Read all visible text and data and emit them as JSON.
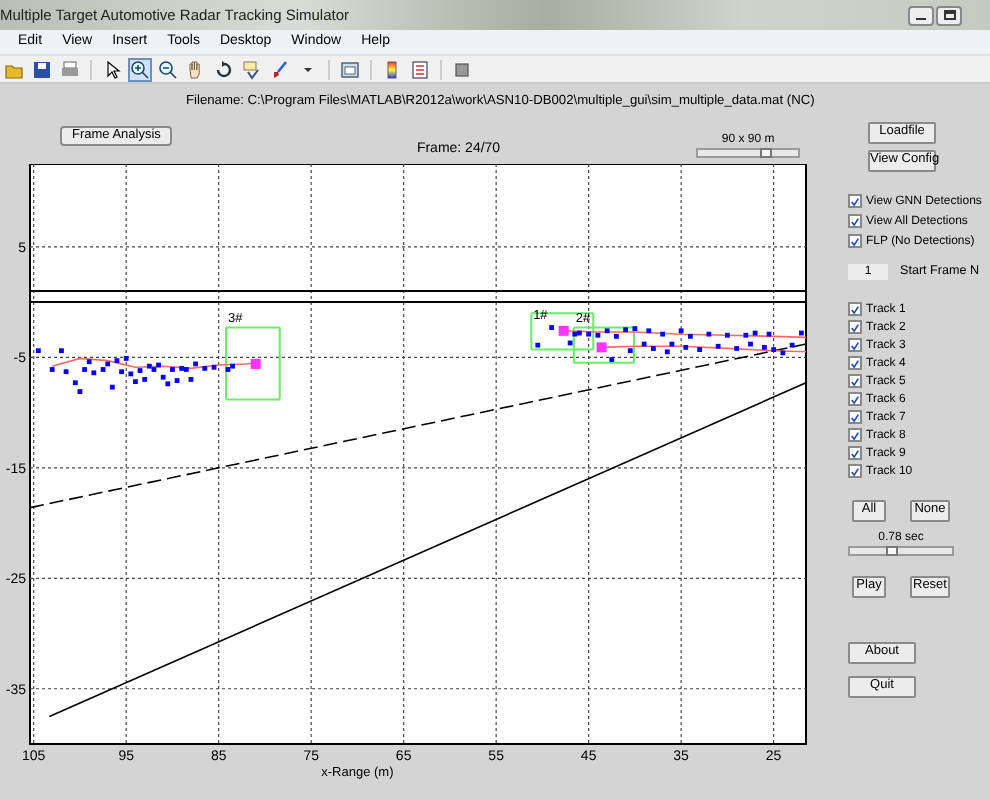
{
  "window": {
    "title": "Multiple Target Automotive Radar Tracking Simulator"
  },
  "menu": [
    "Edit",
    "View",
    "Insert",
    "Tools",
    "Desktop",
    "Window",
    "Help"
  ],
  "toolbar": [
    {
      "selected": false
    },
    {
      "selected": false
    },
    {
      "selected": false
    },
    {
      "selected": false
    },
    {
      "selected": true
    },
    {
      "selected": false
    },
    {
      "selected": false
    },
    {
      "selected": false
    },
    {
      "selected": false
    },
    {
      "selected": false
    },
    {
      "selected": false
    },
    {
      "selected": false
    },
    {
      "selected": false
    },
    {
      "selected": false
    },
    {
      "selected": false
    }
  ],
  "filename": "Filename:  C:\\Program Files\\MATLAB\\R2012a\\work\\ASN10-DB002\\multiple_gui\\sim_multiple_data.mat (NC)",
  "frame_analysis_button": "Frame Analysis",
  "frame_label": "Frame: 24/70",
  "area_slider": {
    "label": "90 x 90 m",
    "level": 0.7
  },
  "plot": {
    "chart_data": {
      "type": "scatter",
      "xlabel": "x-Range (m)",
      "xlim": [
        105.4,
        21.5
      ],
      "ylim": [
        -40,
        12.5
      ],
      "xticks": [
        105,
        95,
        85,
        75,
        65,
        55,
        45,
        35,
        25
      ],
      "yticks": [
        5,
        -5,
        -15,
        -25,
        -35
      ],
      "grid": true,
      "series": [
        {
          "type": "line",
          "color": "#000000",
          "x": [
            105.4,
            21.5
          ],
          "values": [
            1,
            1
          ]
        },
        {
          "type": "line",
          "color": "#000000",
          "x": [
            105.4,
            21.5
          ],
          "values": [
            0,
            0
          ]
        },
        {
          "type": "line",
          "color": "#66ee66",
          "x": [
            84.2,
            78.4
          ],
          "values": [
            -2.3,
            -2.3
          ]
        },
        {
          "type": "line",
          "color": "#66ee66",
          "x": [
            84.2,
            78.4
          ],
          "values": [
            -8.8,
            -8.8
          ]
        },
        {
          "type": "line",
          "color": "#66ee66",
          "x": [
            51.2,
            44.5
          ],
          "values": [
            -1.0,
            -1.0
          ]
        },
        {
          "type": "line",
          "color": "#66ee66",
          "x": [
            51.2,
            44.5
          ],
          "values": [
            -4.3,
            -4.3
          ]
        },
        {
          "type": "line",
          "color": "#66ee66",
          "x": [
            46.6,
            40.1
          ],
          "values": [
            -2.3,
            -2.3
          ]
        },
        {
          "type": "line",
          "color": "#66ee66",
          "x": [
            46.6,
            40.1
          ],
          "values": [
            -5.5,
            -5.5
          ]
        },
        {
          "type": "line",
          "line_style": "dashed",
          "color": "#000000",
          "x": [
            105.4,
            21.5
          ],
          "values": [
            -18.6,
            -3.8
          ]
        },
        {
          "type": "line",
          "color": "#000000",
          "x": [
            103.3,
            21.5
          ],
          "values": [
            -37.5,
            -7.3
          ]
        },
        {
          "type": "line",
          "color": "#ff6666",
          "x": [
            103,
            100,
            97,
            94,
            91,
            88,
            85,
            82,
            81
          ],
          "values": [
            -5.8,
            -5.1,
            -5.3,
            -5.9,
            -5.8,
            -6.0,
            -5.7,
            -5.6,
            -5.5
          ]
        },
        {
          "type": "line",
          "color": "#ff6666",
          "x": [
            47.7,
            44,
            40,
            35,
            30,
            25,
            21.5
          ],
          "values": [
            -2.6,
            -2.7,
            -2.7,
            -2.9,
            -3.0,
            -3.1,
            -3.2
          ]
        },
        {
          "type": "line",
          "color": "#ff6666",
          "x": [
            43.6,
            40,
            35,
            30,
            25,
            21.5
          ],
          "values": [
            -4.1,
            -4.0,
            -4.0,
            -4.2,
            -4.4,
            -4.5
          ]
        },
        {
          "type": "scatter",
          "color": "#0000ff",
          "x": [
            104.5,
            103,
            102,
            101.5,
            100.5,
            100,
            99.5,
            99,
            98.5,
            97.5,
            97,
            96.5,
            96,
            95.5,
            95,
            94.5,
            94,
            93.5,
            93,
            92.5,
            92,
            91.5,
            91,
            90.5,
            90,
            89.5,
            89,
            88.5,
            88,
            87.5,
            86.5,
            85.5,
            84,
            83.5
          ],
          "values": [
            -4.4,
            -6.1,
            -4.4,
            -6.3,
            -7.3,
            -8.1,
            -6.1,
            -5.4,
            -6.4,
            -6.1,
            -5.6,
            -7.7,
            -5.3,
            -6.3,
            -5.1,
            -6.5,
            -7.2,
            -6.2,
            -7.0,
            -5.8,
            -6.1,
            -5.7,
            -6.8,
            -7.4,
            -6.1,
            -7.1,
            -6.0,
            -6.1,
            -7.0,
            -5.6,
            -6.0,
            -5.9,
            -6.1,
            -5.8
          ]
        },
        {
          "type": "scatter",
          "color": "#0000ff",
          "x": [
            50.5,
            49,
            47,
            46.5,
            46,
            45,
            44,
            43,
            42.5,
            42,
            41,
            40.5,
            40,
            39,
            38.5,
            38,
            37,
            36.5,
            36,
            35,
            34.5,
            34,
            33,
            32,
            31,
            30,
            29,
            28,
            27.5,
            27,
            26,
            25.5,
            25,
            24,
            23,
            22
          ],
          "values": [
            -3.9,
            -2.3,
            -3.7,
            -2.9,
            -2.8,
            -2.9,
            -3.0,
            -2.6,
            -5.2,
            -3.1,
            -2.5,
            -4.4,
            -2.4,
            -3.8,
            -2.6,
            -4.2,
            -2.9,
            -4.5,
            -3.8,
            -2.6,
            -4.1,
            -3.1,
            -4.3,
            -2.9,
            -4.0,
            -3.0,
            -4.2,
            -3.0,
            -3.8,
            -2.8,
            -4.1,
            -2.9,
            -4.3,
            -4.6,
            -3.9,
            -2.8
          ]
        },
        {
          "type": "scatter",
          "marker": "square",
          "color": "#ff33ff",
          "x": [
            81,
            47.7,
            43.6
          ],
          "values": [
            -5.6,
            -2.6,
            -4.1
          ]
        }
      ],
      "annotations": [
        {
          "text": "3#",
          "x": 84,
          "y": -1.8
        },
        {
          "text": "1#",
          "x": 51,
          "y": -1.5
        },
        {
          "text": "2#",
          "x": 46.4,
          "y": -1.8
        }
      ]
    }
  },
  "controls": {
    "loadfile": "Loadfile",
    "view_config": "View Config",
    "view_options": [
      {
        "label": "View GNN Detections",
        "checked": true
      },
      {
        "label": "View All Detections",
        "checked": true
      },
      {
        "label": "FLP (No Detections)",
        "checked": true
      }
    ],
    "start_frame": {
      "value": "1",
      "label": "Start Frame N"
    },
    "tracks": [
      {
        "label": "Track 1",
        "checked": true
      },
      {
        "label": "Track 2",
        "checked": true
      },
      {
        "label": "Track 3",
        "checked": true
      },
      {
        "label": "Track 4",
        "checked": true
      },
      {
        "label": "Track 5",
        "checked": true
      },
      {
        "label": "Track 6",
        "checked": true
      },
      {
        "label": "Track 7",
        "checked": true
      },
      {
        "label": "Track 8",
        "checked": true
      },
      {
        "label": "Track 9",
        "checked": true
      },
      {
        "label": "Track 10",
        "checked": true
      }
    ],
    "all": "All",
    "none": "None",
    "speed_slider": {
      "label": "0.78 sec",
      "level": 0.4
    },
    "play": "Play",
    "reset": "Reset",
    "about": "About",
    "quit": "Quit"
  }
}
